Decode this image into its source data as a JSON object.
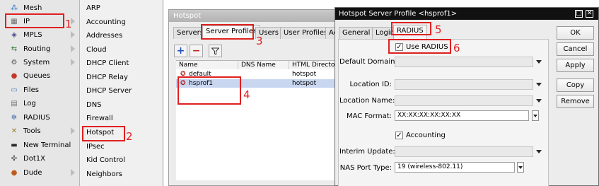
{
  "left_nav": {
    "items": [
      {
        "label": "Mesh",
        "icon": "mesh-icon",
        "glyph": "⁂",
        "color": "#3a78c9",
        "submenu": false
      },
      {
        "label": "IP",
        "icon": "ip-icon",
        "glyph": "▦",
        "color": "#6c6c6c",
        "submenu": true
      },
      {
        "label": "MPLS",
        "icon": "mpls-icon",
        "glyph": "◈",
        "color": "#4a4a8a",
        "submenu": true
      },
      {
        "label": "Routing",
        "icon": "routing-icon",
        "glyph": "⇆",
        "color": "#2f7f2f",
        "submenu": true
      },
      {
        "label": "System",
        "icon": "system-icon",
        "glyph": "⚙",
        "color": "#5a5a5a",
        "submenu": true
      },
      {
        "label": "Queues",
        "icon": "queues-icon",
        "glyph": "●",
        "color": "#c0392b",
        "submenu": false
      },
      {
        "label": "Files",
        "icon": "files-icon",
        "glyph": "▭",
        "color": "#4f7fbf",
        "submenu": false
      },
      {
        "label": "Log",
        "icon": "log-icon",
        "glyph": "▤",
        "color": "#707070",
        "submenu": false
      },
      {
        "label": "RADIUS",
        "icon": "radius-icon",
        "glyph": "✲",
        "color": "#3a6aa8",
        "submenu": false
      },
      {
        "label": "Tools",
        "icon": "tools-icon",
        "glyph": "✕",
        "color": "#9a7a2a",
        "submenu": true
      },
      {
        "label": "New Terminal",
        "icon": "terminal-icon",
        "glyph": "▬",
        "color": "#2a2a2a",
        "submenu": false
      },
      {
        "label": "Dot1X",
        "icon": "dot1x-icon",
        "glyph": "✣",
        "color": "#3a3a3a",
        "submenu": false
      },
      {
        "label": "Dude",
        "icon": "dude-icon",
        "glyph": "●",
        "color": "#c05a1a",
        "submenu": true
      }
    ]
  },
  "submenu": {
    "items": [
      "ARP",
      "Accounting",
      "Addresses",
      "Cloud",
      "DHCP Client",
      "DHCP Relay",
      "DHCP Server",
      "DNS",
      "Firewall",
      "Hotspot",
      "IPsec",
      "Kid Control",
      "Neighbors"
    ]
  },
  "hotspot_window": {
    "title": "Hotspot",
    "tabs": [
      "Servers",
      "Server Profiles",
      "Users",
      "User Profiles",
      "Ac"
    ],
    "active_tab": "Server Profiles",
    "columns": [
      "Name",
      "DNS Name",
      "HTML Directo"
    ],
    "rows": [
      {
        "name": "default",
        "dns_name": "",
        "html_directory": "hotspot"
      },
      {
        "name": "hsprof1",
        "dns_name": "",
        "html_directory": "hotspot"
      }
    ]
  },
  "profile_dialog": {
    "title": "Hotspot Server Profile <hsprof1>",
    "tabs": [
      "General",
      "Login",
      "RADIUS"
    ],
    "active_tab": "RADIUS",
    "use_radius": {
      "label": "Use RADIUS",
      "checked": true
    },
    "default_domain": {
      "label": "Default Domain",
      "value": ""
    },
    "location_id": {
      "label": "Location ID:",
      "value": ""
    },
    "location_name": {
      "label": "Location Name:",
      "value": ""
    },
    "mac_format": {
      "label": "MAC Format:",
      "value": "XX:XX:XX:XX:XX:XX"
    },
    "accounting": {
      "label": "Accounting",
      "checked": true
    },
    "interim_update": {
      "label": "Interim Update:",
      "value": ""
    },
    "nas_port_type": {
      "label": "NAS Port Type:",
      "value": "19 (wireless-802.11)"
    },
    "buttons": {
      "ok": "OK",
      "cancel": "Cancel",
      "apply": "Apply",
      "copy": "Copy",
      "remove": "Remove"
    }
  },
  "annotations": [
    "1",
    "2",
    "3",
    "4",
    "5",
    "6"
  ],
  "colors": {
    "annotation": "#e02020",
    "selected_row": "#c8d6f0",
    "nav_bg": "#e6e6e6",
    "dialog_title_bg": "#111111"
  }
}
